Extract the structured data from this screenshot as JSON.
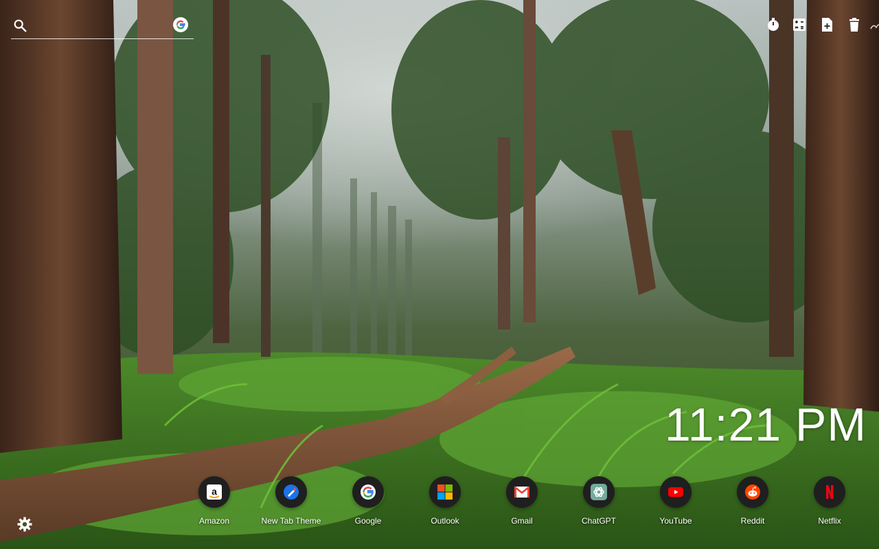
{
  "search": {
    "placeholder": ""
  },
  "clock": {
    "time": "11:21 PM"
  },
  "shortcuts": [
    {
      "label": "Amazon",
      "icon": "amazon-icon"
    },
    {
      "label": "New Tab Theme",
      "icon": "new-tab-theme-icon"
    },
    {
      "label": "Google",
      "icon": "google-icon"
    },
    {
      "label": "Outlook",
      "icon": "outlook-icon"
    },
    {
      "label": "Gmail",
      "icon": "gmail-icon"
    },
    {
      "label": "ChatGPT",
      "icon": "chatgpt-icon"
    },
    {
      "label": "YouTube",
      "icon": "youtube-icon"
    },
    {
      "label": "Reddit",
      "icon": "reddit-icon"
    },
    {
      "label": "Netflix",
      "icon": "netflix-icon"
    }
  ],
  "toolbar": {
    "icons": [
      "timer-icon",
      "calculator-icon",
      "add-note-icon",
      "trash-icon",
      "logo-icon"
    ]
  },
  "colors": {
    "youtube": "#ff0000",
    "netflix": "#e50914",
    "reddit": "#ff4500",
    "google_blue": "#4285f4",
    "google_red": "#ea4335",
    "google_yellow": "#fbbc05",
    "google_green": "#34a853"
  }
}
